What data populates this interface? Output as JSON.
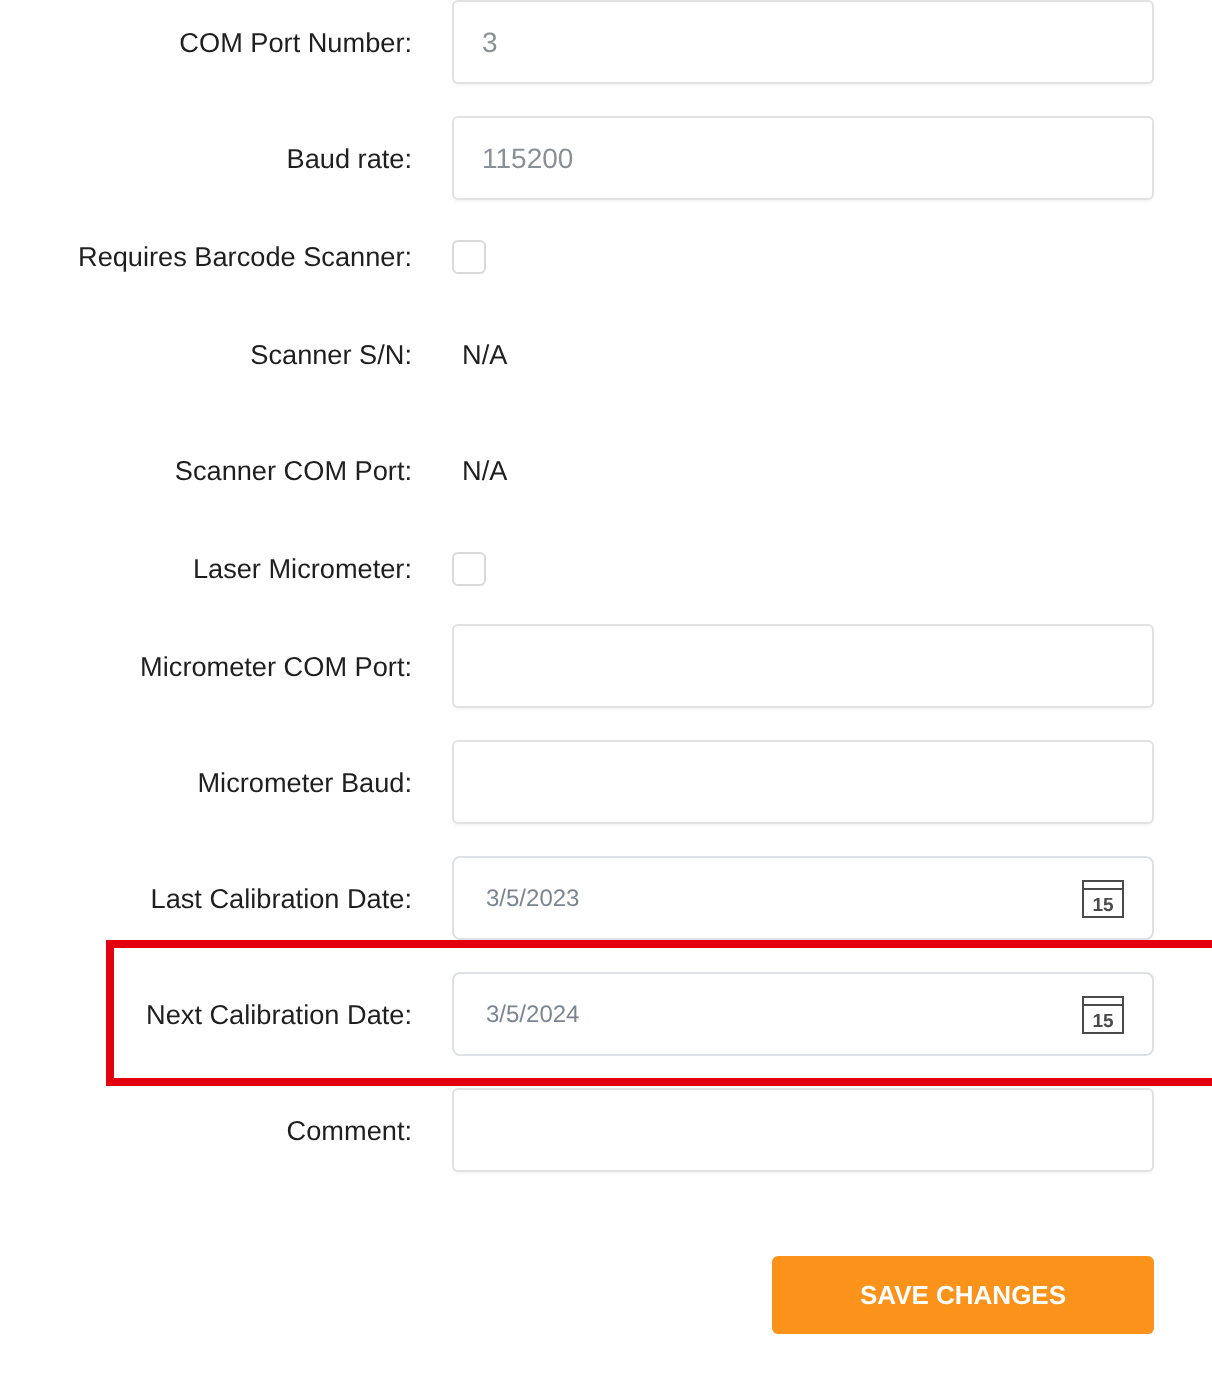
{
  "fields": [
    {
      "label": "COM Port Number:",
      "kind": "text",
      "value": "3",
      "highlighted": false
    },
    {
      "label": "Baud rate:",
      "kind": "text",
      "value": "115200",
      "highlighted": false
    },
    {
      "label": "Requires Barcode Scanner:",
      "kind": "checkbox",
      "checked": false,
      "highlighted": false
    },
    {
      "label": "Scanner S/N:",
      "kind": "static",
      "value": "N/A",
      "highlighted": false
    },
    {
      "label": "Scanner COM Port:",
      "kind": "static",
      "value": "N/A",
      "highlighted": false
    },
    {
      "label": "Laser Micrometer:",
      "kind": "checkbox",
      "checked": false,
      "highlighted": false
    },
    {
      "label": "Micrometer COM Port:",
      "kind": "text",
      "highlighted": false
    },
    {
      "label": "Micrometer Baud:",
      "kind": "text",
      "highlighted": false
    },
    {
      "label": "Last Calibration Date:",
      "kind": "date",
      "value": "3/5/2023",
      "icon_day": "15",
      "highlighted": false
    },
    {
      "label": "Next Calibration Date:",
      "kind": "date",
      "value": "3/5/2024",
      "icon_day": "15",
      "highlighted": true
    },
    {
      "label": "Comment:",
      "kind": "text",
      "highlighted": false
    }
  ],
  "save_button": {
    "label": "SAVE CHANGES"
  }
}
